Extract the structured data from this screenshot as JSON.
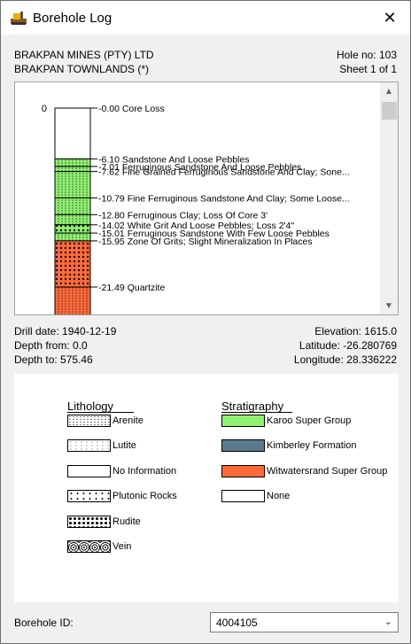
{
  "window": {
    "title": "Borehole Log",
    "close_icon": "close-icon",
    "app_icon": "excavator-icon"
  },
  "header": {
    "company": "BRAKPAN MINES (PTY) LTD",
    "location": "BRAKPAN TOWNLANDS (*)",
    "hole_no": "Hole no: 103",
    "sheet": "Sheet 1 of 1"
  },
  "log": {
    "depth_start_label": "0",
    "layers": [
      {
        "label": "-0.00 Core Loss",
        "depth": 0.0,
        "strat": "None",
        "litho": "No Information"
      },
      {
        "label": "-6.10 Sandstone And Loose Pebbles",
        "depth": 6.1,
        "strat": "Karoo Super Group",
        "litho": "Arenite"
      },
      {
        "label": "-7.01 Ferruginous Sandstone And Loose Pebbles",
        "depth": 7.01,
        "strat": "Karoo Super Group",
        "litho": "Arenite"
      },
      {
        "label": "-7.62 Fine Grained Ferruginous Sandstone And Clay; Sone...",
        "depth": 7.62,
        "strat": "Karoo Super Group",
        "litho": "Arenite"
      },
      {
        "label": "-10.79 Fine Ferruginous Sandstone And Clay; Some Loose...",
        "depth": 10.79,
        "strat": "Karoo Super Group",
        "litho": "Arenite"
      },
      {
        "label": "-12.80 Ferruginous Clay; Loss Of Core 3'",
        "depth": 12.8,
        "strat": "Karoo Super Group",
        "litho": "Arenite"
      },
      {
        "label": "-14.02 White Grit And Loose Pebbles; Loss 2'4\"",
        "depth": 14.02,
        "strat": "Karoo Super Group",
        "litho": "Rudite"
      },
      {
        "label": "-15.01 Ferruginous Sandstone With Few Loose Pebbles",
        "depth": 15.01,
        "strat": "Karoo Super Group",
        "litho": "Arenite"
      },
      {
        "label": "-15.95 Zone Of Grits; Slight Mineralization In Places",
        "depth": 15.95,
        "strat": "Witwatersrand Super Group",
        "litho": "Rudite"
      },
      {
        "label": "-21.49 Quartzite",
        "depth": 21.49,
        "strat": "Witwatersrand Super Group",
        "litho": "Arenite"
      }
    ]
  },
  "info": {
    "drill_date": "Drill date: 1940-12-19",
    "depth_from": "Depth from: 0.0",
    "depth_to": "Depth to: 575.46",
    "elevation": "Elevation: 1615.0",
    "latitude": "Latitude: -26.280769",
    "longitude": "Longitude: 28.336222"
  },
  "legend": {
    "lithology_title": "Lithology",
    "stratigraphy_title": "Stratigraphy",
    "lithology": [
      {
        "label": "Arenite",
        "pattern": "arenite"
      },
      {
        "label": "Lutite",
        "pattern": "lutite"
      },
      {
        "label": "No Information",
        "pattern": "none"
      },
      {
        "label": "Plutonic Rocks",
        "pattern": "plutonic"
      },
      {
        "label": "Rudite",
        "pattern": "rudite"
      },
      {
        "label": "Vein",
        "pattern": "vein"
      }
    ],
    "stratigraphy": [
      {
        "label": "Karoo Super Group",
        "color": "#90f070"
      },
      {
        "label": "Kimberley Formation",
        "color": "#5a7a90"
      },
      {
        "label": "Witwatersrand Super Group",
        "color": "#ff6a3a"
      },
      {
        "label": "None",
        "color": "#ffffff"
      }
    ]
  },
  "footer": {
    "borehole_id_label": "Borehole ID:",
    "borehole_id_value": "4004105"
  }
}
